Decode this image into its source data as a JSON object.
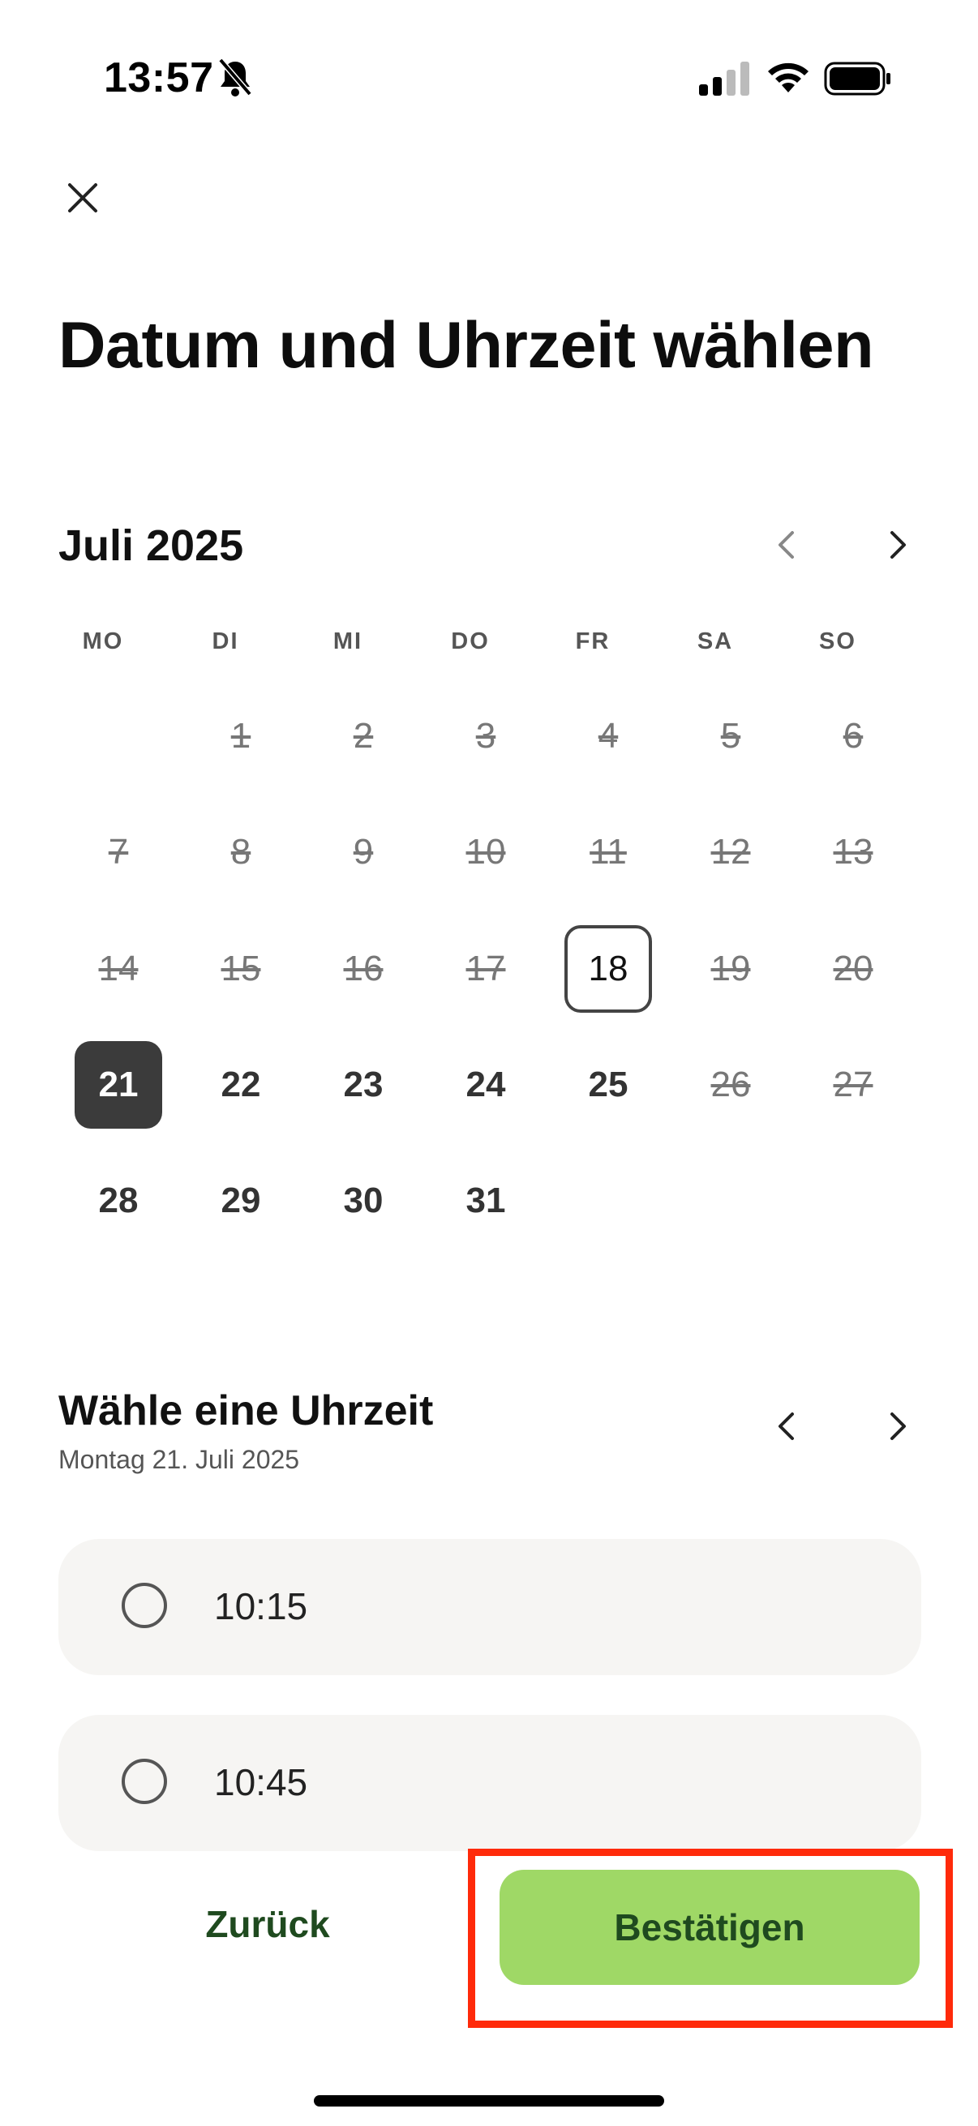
{
  "status_bar": {
    "time": "13:57",
    "icons": [
      "bell-slash-icon",
      "cellular-signal-icon",
      "wifi-icon",
      "battery-icon"
    ]
  },
  "header": {
    "close_icon": "close-icon",
    "title": "Datum und Uhrzeit wählen"
  },
  "calendar": {
    "month_label": "Juli 2025",
    "prev_icon": "chevron-left-icon",
    "next_icon": "chevron-right-icon",
    "weekdays": [
      "MO",
      "DI",
      "MI",
      "DO",
      "FR",
      "SA",
      "SO"
    ],
    "days": [
      {
        "label": "1",
        "state": "disabled"
      },
      {
        "label": "2",
        "state": "disabled"
      },
      {
        "label": "3",
        "state": "disabled"
      },
      {
        "label": "4",
        "state": "disabled"
      },
      {
        "label": "5",
        "state": "disabled"
      },
      {
        "label": "6",
        "state": "disabled"
      },
      {
        "label": "7",
        "state": "disabled"
      },
      {
        "label": "8",
        "state": "disabled"
      },
      {
        "label": "9",
        "state": "disabled"
      },
      {
        "label": "10",
        "state": "disabled"
      },
      {
        "label": "11",
        "state": "disabled"
      },
      {
        "label": "12",
        "state": "disabled"
      },
      {
        "label": "13",
        "state": "disabled"
      },
      {
        "label": "14",
        "state": "disabled"
      },
      {
        "label": "15",
        "state": "disabled"
      },
      {
        "label": "16",
        "state": "disabled"
      },
      {
        "label": "17",
        "state": "disabled"
      },
      {
        "label": "18",
        "state": "today"
      },
      {
        "label": "19",
        "state": "disabled"
      },
      {
        "label": "20",
        "state": "disabled"
      },
      {
        "label": "21",
        "state": "selected"
      },
      {
        "label": "22",
        "state": "available"
      },
      {
        "label": "23",
        "state": "available"
      },
      {
        "label": "24",
        "state": "available"
      },
      {
        "label": "25",
        "state": "available"
      },
      {
        "label": "26",
        "state": "disabled"
      },
      {
        "label": "27",
        "state": "disabled"
      },
      {
        "label": "28",
        "state": "available"
      },
      {
        "label": "29",
        "state": "available"
      },
      {
        "label": "30",
        "state": "available"
      },
      {
        "label": "31",
        "state": "available"
      }
    ]
  },
  "time_picker": {
    "title": "Wähle eine Uhrzeit",
    "subtitle": "Montag 21. Juli 2025",
    "slots": [
      {
        "label": "10:15",
        "selected": false
      },
      {
        "label": "10:45",
        "selected": false
      }
    ]
  },
  "actions": {
    "back_label": "Zurück",
    "confirm_label": "Bestätigen"
  },
  "colors": {
    "confirm_bg": "#9fd866",
    "confirm_text": "#1f4a1f",
    "selected_day_bg": "#3b3b3b",
    "slot_bg": "#f6f5f3",
    "highlight_border": "#ff2a0a"
  }
}
